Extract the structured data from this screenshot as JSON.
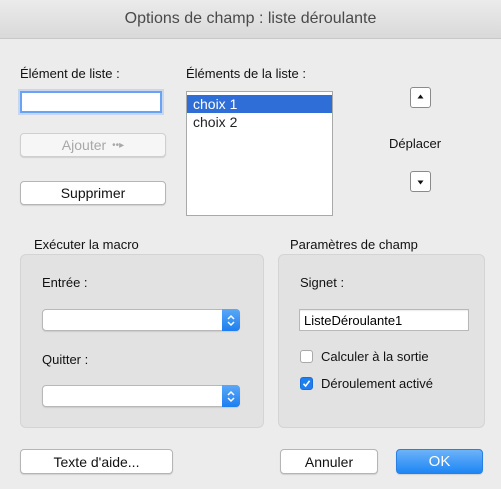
{
  "window": {
    "title": "Options de champ : liste déroulante"
  },
  "list_item": {
    "label": "Élément de liste :",
    "value": ""
  },
  "list_items": {
    "label": "Éléments de la liste :",
    "items": [
      "choix 1",
      "choix 2"
    ],
    "selected_index": 0
  },
  "buttons": {
    "add": "Ajouter",
    "add_glyph": "••▸",
    "remove": "Supprimer",
    "help": "Texte d'aide...",
    "cancel": "Annuler",
    "ok": "OK"
  },
  "move": {
    "label": "Déplacer"
  },
  "macro": {
    "title": "Exécuter la macro",
    "entry_label": "Entrée :",
    "entry_value": "",
    "exit_label": "Quitter :",
    "exit_value": ""
  },
  "field_settings": {
    "title": "Paramètres de champ",
    "bookmark_label": "Signet :",
    "bookmark_value": "ListeDéroulante1",
    "calculate_on_exit": {
      "label": "Calculer à la sortie",
      "checked": false
    },
    "dropdown_enabled": {
      "label": "Déroulement activé",
      "checked": true
    }
  },
  "colors": {
    "accent": "#1f7ff0",
    "selection": "#2f6ed6"
  }
}
